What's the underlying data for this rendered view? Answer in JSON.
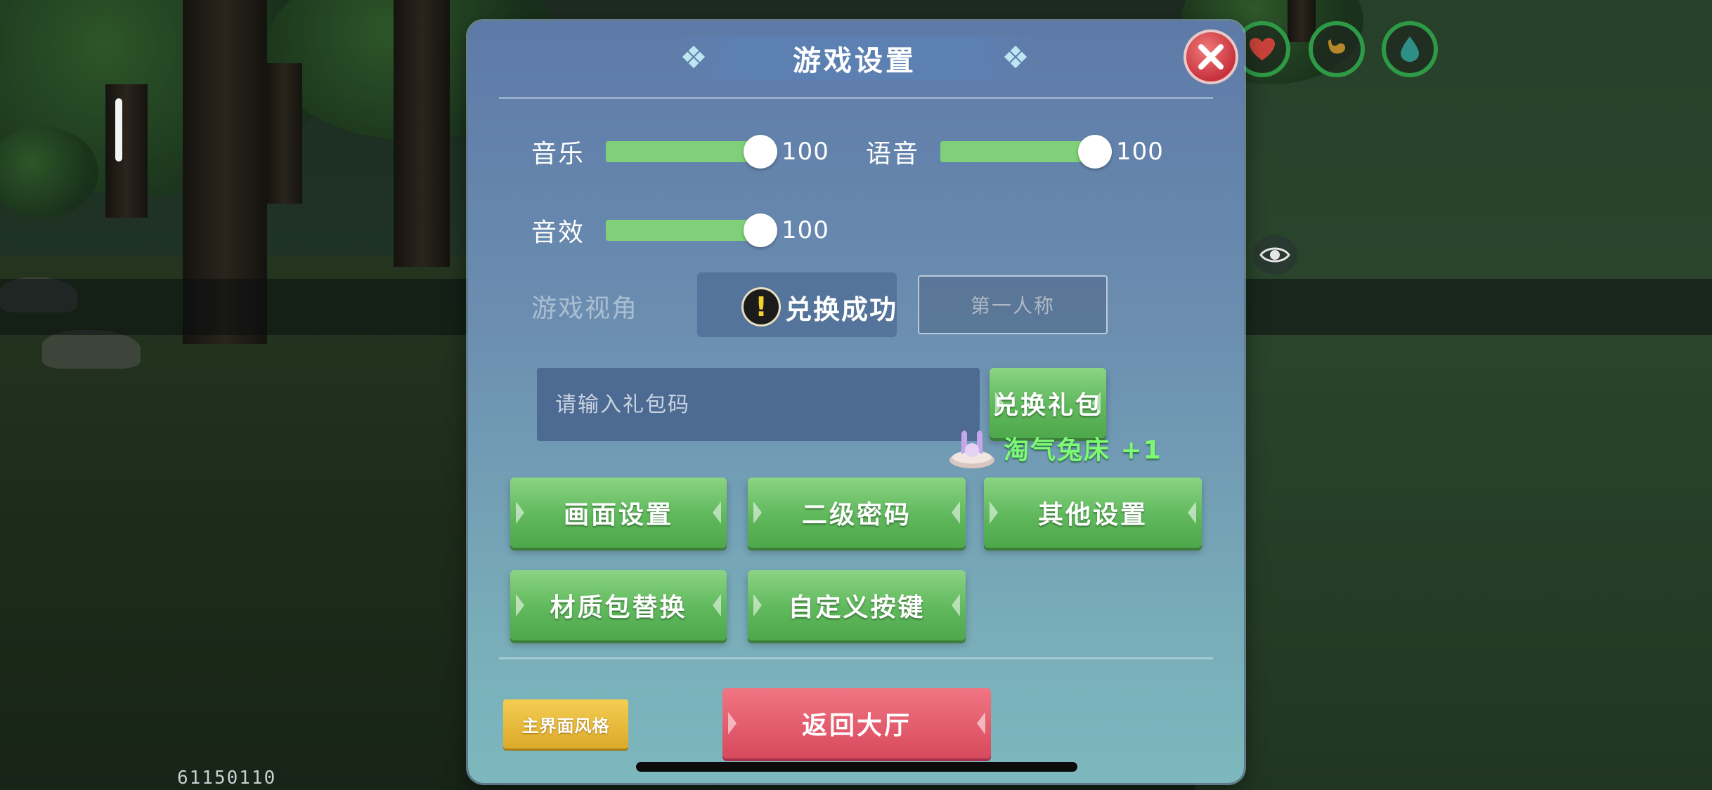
{
  "panel": {
    "title": "游戏设置"
  },
  "sliders": [
    {
      "label": "音乐",
      "value_text": "100",
      "value": 100,
      "max": 100
    },
    {
      "label": "语音",
      "value_text": "100",
      "value": 100,
      "max": 100
    },
    {
      "label": "音效",
      "value_text": "100",
      "value": 100,
      "max": 100
    }
  ],
  "view": {
    "label": "游戏视角",
    "option_second": "第一人称"
  },
  "toast": {
    "icon": "exclamation-icon",
    "text": "兑换成功"
  },
  "gift": {
    "placeholder": "请输入礼包码",
    "redeem_label": "兑换礼包",
    "reward_text": "淘气兔床 +1",
    "reward_icon": "bunny-bed-icon"
  },
  "buttons": {
    "graphics": "画面设置",
    "second_password": "二级密码",
    "other": "其他设置",
    "texture_pack": "材质包替换",
    "custom_keys": "自定义按键",
    "main_style": "主界面风格",
    "return_lobby": "返回大厅"
  },
  "hud": {
    "build_id": "61150110",
    "status_icons": [
      "heart-icon",
      "stomach-icon",
      "water-drop-icon"
    ]
  },
  "colors": {
    "accent_green": "#7fd078",
    "close_red": "#d8495d",
    "gold": "#e6b83a",
    "reward_green": "#7dfa73"
  }
}
